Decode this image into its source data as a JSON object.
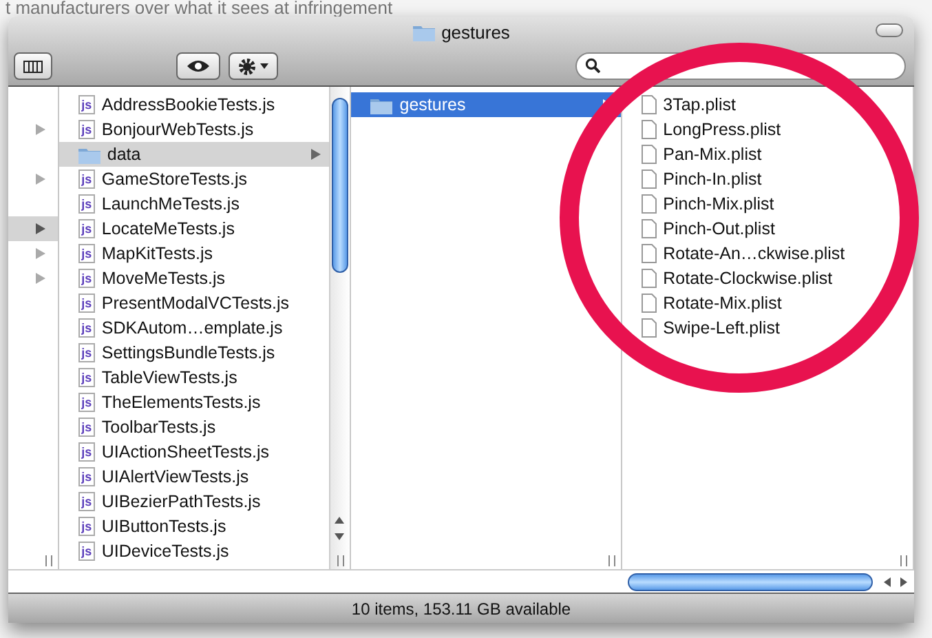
{
  "background_text": "t manufacturers over what it sees at infringement",
  "window": {
    "title": "gestures"
  },
  "column_1": {
    "rows": [
      {
        "arrow": false,
        "selected": false
      },
      {
        "arrow": true,
        "selected": false
      },
      {
        "arrow": false,
        "selected": false
      },
      {
        "arrow": true,
        "selected": false
      },
      {
        "arrow": false,
        "selected": false
      },
      {
        "arrow": true,
        "selected": true
      },
      {
        "arrow": true,
        "selected": false
      },
      {
        "arrow": true,
        "selected": false
      }
    ]
  },
  "column_2": {
    "items": [
      {
        "kind": "js",
        "badge": "js",
        "name": "AddressBookieTests.js",
        "selected": false
      },
      {
        "kind": "js",
        "badge": "js",
        "name": "BonjourWebTests.js",
        "selected": false
      },
      {
        "kind": "folder",
        "name": "data",
        "selected": true
      },
      {
        "kind": "js",
        "badge": "js",
        "name": "GameStoreTests.js",
        "selected": false
      },
      {
        "kind": "js",
        "badge": "js",
        "name": "LaunchMeTests.js",
        "selected": false
      },
      {
        "kind": "js",
        "badge": "js",
        "name": "LocateMeTests.js",
        "selected": false
      },
      {
        "kind": "js",
        "badge": "js",
        "name": "MapKitTests.js",
        "selected": false
      },
      {
        "kind": "js",
        "badge": "js",
        "name": "MoveMeTests.js",
        "selected": false
      },
      {
        "kind": "js",
        "badge": "js",
        "name": "PresentModalVCTests.js",
        "selected": false
      },
      {
        "kind": "js",
        "badge": "js",
        "name": "SDKAutom…emplate.js",
        "selected": false
      },
      {
        "kind": "js",
        "badge": "js",
        "name": "SettingsBundleTests.js",
        "selected": false
      },
      {
        "kind": "js",
        "badge": "js",
        "name": "TableViewTests.js",
        "selected": false
      },
      {
        "kind": "js",
        "badge": "js",
        "name": "TheElementsTests.js",
        "selected": false
      },
      {
        "kind": "js",
        "badge": "js",
        "name": "ToolbarTests.js",
        "selected": false
      },
      {
        "kind": "js",
        "badge": "js",
        "name": "UIActionSheetTests.js",
        "selected": false
      },
      {
        "kind": "js",
        "badge": "js",
        "name": "UIAlertViewTests.js",
        "selected": false
      },
      {
        "kind": "js",
        "badge": "js",
        "name": "UIBezierPathTests.js",
        "selected": false
      },
      {
        "kind": "js",
        "badge": "js",
        "name": "UIButtonTests.js",
        "selected": false
      },
      {
        "kind": "js",
        "badge": "js",
        "name": "UIDeviceTests.js",
        "selected": false
      }
    ]
  },
  "column_3": {
    "items": [
      {
        "kind": "folder",
        "name": "gestures",
        "selected": true
      }
    ]
  },
  "column_4": {
    "items": [
      {
        "kind": "file",
        "name": "3Tap.plist",
        "selected": false
      },
      {
        "kind": "file",
        "name": "LongPress.plist",
        "selected": false
      },
      {
        "kind": "file",
        "name": "Pan-Mix.plist",
        "selected": false
      },
      {
        "kind": "file",
        "name": "Pinch-In.plist",
        "selected": false
      },
      {
        "kind": "file",
        "name": "Pinch-Mix.plist",
        "selected": false
      },
      {
        "kind": "file",
        "name": "Pinch-Out.plist",
        "selected": false
      },
      {
        "kind": "file",
        "name": "Rotate-An…ckwise.plist",
        "selected": false
      },
      {
        "kind": "file",
        "name": "Rotate-Clockwise.plist",
        "selected": false
      },
      {
        "kind": "file",
        "name": "Rotate-Mix.plist",
        "selected": false
      },
      {
        "kind": "file",
        "name": "Swipe-Left.plist",
        "selected": false
      }
    ]
  },
  "status_bar": {
    "text": "10 items, 153.11 GB available"
  }
}
